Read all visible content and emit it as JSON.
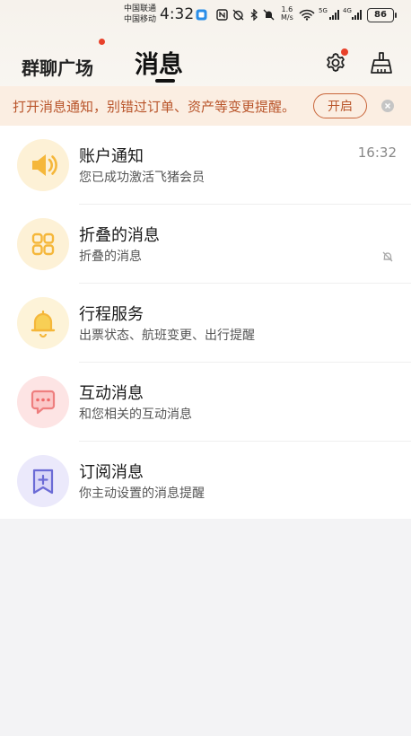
{
  "status_bar": {
    "carrier_1": "中国联通",
    "carrier_2": "中国移动",
    "time": "4:32",
    "net_speed_value": "1.6",
    "net_speed_unit": "M/s",
    "signal_1_label": "5G",
    "signal_2_label": "4G",
    "battery": "86"
  },
  "header": {
    "tab_group_chat": "群聊广场",
    "tab_messages": "消息",
    "settings_icon": "gear-icon",
    "clean_icon": "broom-icon"
  },
  "notice_banner": {
    "text": "打开消息通知，别错过订单、资产等变更提醒。",
    "button": "开启"
  },
  "messages": [
    {
      "title": "账户通知",
      "subtitle": "您已成功激活飞猪会员",
      "time": "16:32",
      "icon": "speaker-icon",
      "color": "#f5b73a"
    },
    {
      "title": "折叠的消息",
      "subtitle": "折叠的消息",
      "time": "",
      "icon": "grid-icon",
      "color": "#f5b73a",
      "muted": true
    },
    {
      "title": "行程服务",
      "subtitle": "出票状态、航班变更、出行提醒",
      "time": "",
      "icon": "bell-icon",
      "color": "#f5c13a"
    },
    {
      "title": "互动消息",
      "subtitle": "和您相关的互动消息",
      "time": "",
      "icon": "chat-bubble-icon",
      "color": "#f07b7b"
    },
    {
      "title": "订阅消息",
      "subtitle": "你主动设置的消息提醒",
      "time": "",
      "icon": "bookmark-plus-icon",
      "color": "#6b6bd6"
    }
  ]
}
